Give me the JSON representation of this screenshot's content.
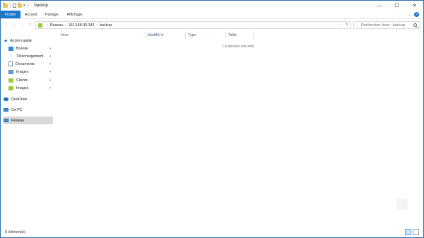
{
  "window": {
    "title": "backup"
  },
  "window_controls": {
    "minimize": "—",
    "maximize": "☐",
    "close": "✕"
  },
  "ribbon": {
    "tabs": [
      "Fichier",
      "Accueil",
      "Partage",
      "Affichage"
    ],
    "expand_icon": "chevron-down-icon",
    "help_icon": "?"
  },
  "address_bar": {
    "breadcrumbs": [
      "Réseau",
      "192.168.93.243",
      "backup"
    ],
    "search_placeholder": "Rechercher dans : backup"
  },
  "sidebar": {
    "quick_access": "Accès rapide",
    "pinned": [
      "Bureau",
      "Téléchargement",
      "Documents",
      "Images",
      "Clients",
      "Images"
    ],
    "onedrive": "OneDrive",
    "this_pc": "Ce PC",
    "network": "Réseau"
  },
  "columns": [
    "Nom",
    "Modifié le",
    "Type",
    "Taille"
  ],
  "empty_message": "Le dossier est vide.",
  "status": {
    "items_count": "0 élément(s)"
  }
}
